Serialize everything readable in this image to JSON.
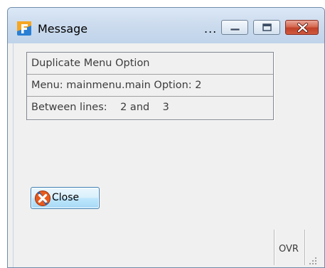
{
  "window": {
    "title": "Message",
    "title_overflow": "...",
    "controls": {
      "minimize_icon": "minimize-icon",
      "maximize_icon": "maximize-icon",
      "close_icon": "close-icon"
    }
  },
  "message": {
    "lines": [
      "Duplicate Menu Option",
      "Menu: mainmenu.main Option: 2",
      "Between lines:    2 and    3"
    ]
  },
  "buttons": {
    "close_label": "Close",
    "close_icon": "close-x-icon"
  },
  "status": {
    "mode": "OVR"
  },
  "colors": {
    "titlebar": "#cddcee",
    "close_control": "#c04128",
    "button_border": "#3c7fb1",
    "client_bg": "#f0f0f0"
  }
}
